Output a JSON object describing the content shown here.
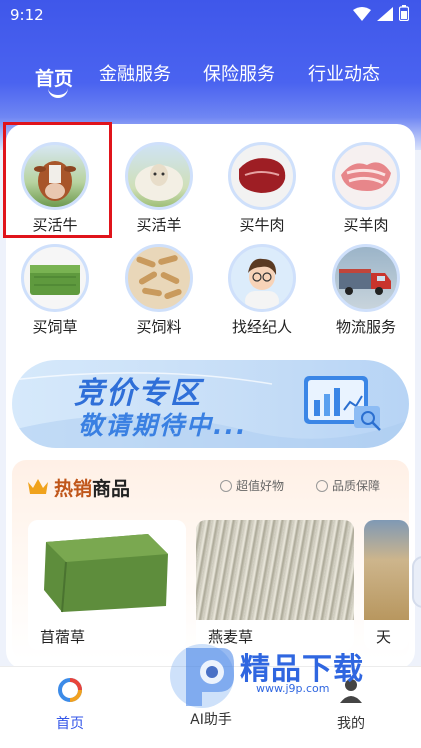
{
  "status_bar": {
    "time": "9:12"
  },
  "top_tabs": [
    "首页",
    "金融服务",
    "保险服务",
    "行业动态"
  ],
  "categories": [
    {
      "label": "买活牛",
      "icon": "cattle-icon"
    },
    {
      "label": "买活羊",
      "icon": "sheep-icon"
    },
    {
      "label": "买牛肉",
      "icon": "beef-icon"
    },
    {
      "label": "买羊肉",
      "icon": "mutton-icon"
    },
    {
      "label": "买饲草",
      "icon": "hay-bale-icon"
    },
    {
      "label": "买饲料",
      "icon": "feed-pellet-icon"
    },
    {
      "label": "找经纪人",
      "icon": "agent-avatar-icon"
    },
    {
      "label": "物流服务",
      "icon": "truck-icon"
    }
  ],
  "banner": {
    "title": "竞价专区",
    "subtitle": "敬请期待中..."
  },
  "hot_section": {
    "title_accent": "热销",
    "title_rest": "商品",
    "perks": [
      "超值好物",
      "品质保障"
    ],
    "products": [
      {
        "name": "苜蓿草"
      },
      {
        "name": "燕麦草"
      },
      {
        "name": "天"
      }
    ]
  },
  "bottom_nav": [
    {
      "label": "首页",
      "icon": "home-logo-icon",
      "active": true
    },
    {
      "label": "AI助手",
      "icon": "ai-assistant-icon",
      "active": false
    },
    {
      "label": "我的",
      "icon": "profile-icon",
      "active": false
    }
  ],
  "watermark": {
    "text": "精品下载",
    "url": "www.j9p.com"
  },
  "colors": {
    "primary": "#3f57ea",
    "highlight": "#e0141b",
    "accent_orange": "#c0561a"
  }
}
